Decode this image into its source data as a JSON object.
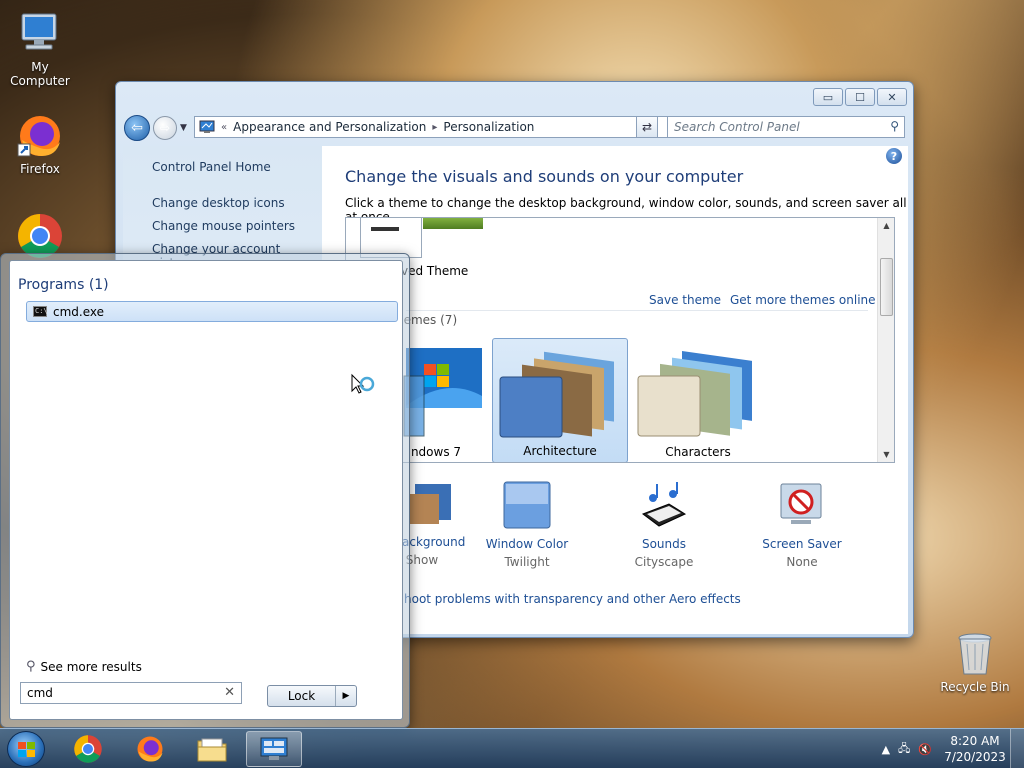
{
  "desktop": {
    "icons": [
      {
        "label": "My Computer"
      },
      {
        "label": "Firefox"
      },
      {
        "label": "Recycle Bin"
      }
    ]
  },
  "control_panel": {
    "address": {
      "prefix": "«",
      "crumbs": [
        "Appearance and Personalization",
        "Personalization"
      ]
    },
    "search_placeholder": "Search Control Panel",
    "sidebar": {
      "home": "Control Panel Home",
      "links": [
        "Change desktop icons",
        "Change mouse pointers",
        "Change your account picture"
      ]
    },
    "title": "Change the visuals and sounds on your computer",
    "subtitle": "Click a theme to change the desktop background, window color, sounds, and screen saver all at once.",
    "themes": {
      "unsaved_label": "ved Theme",
      "save_theme": "Save theme",
      "get_more": "Get more themes online",
      "group_label": "hemes (7)",
      "tiles": [
        {
          "label": "ndows 7",
          "selected": false
        },
        {
          "label": "Architecture",
          "selected": true
        },
        {
          "label": "Characters",
          "selected": false
        }
      ]
    },
    "bottom": [
      {
        "name": "ackground",
        "value": "Show"
      },
      {
        "name": "Window Color",
        "value": "Twilight"
      },
      {
        "name": "Sounds",
        "value": "Cityscape"
      },
      {
        "name": "Screen Saver",
        "value": "None"
      }
    ],
    "trouble_link": "hoot problems with transparency and other Aero effects"
  },
  "start_menu": {
    "programs_heading": "Programs (1)",
    "results": [
      "cmd.exe"
    ],
    "see_more": "See more results",
    "search_value": "cmd",
    "lock_label": "Lock"
  },
  "taskbar": {
    "time": "8:20 AM",
    "date": "7/20/2023"
  },
  "colors": {
    "link": "#1e4f95",
    "title": "#1e3d78"
  }
}
